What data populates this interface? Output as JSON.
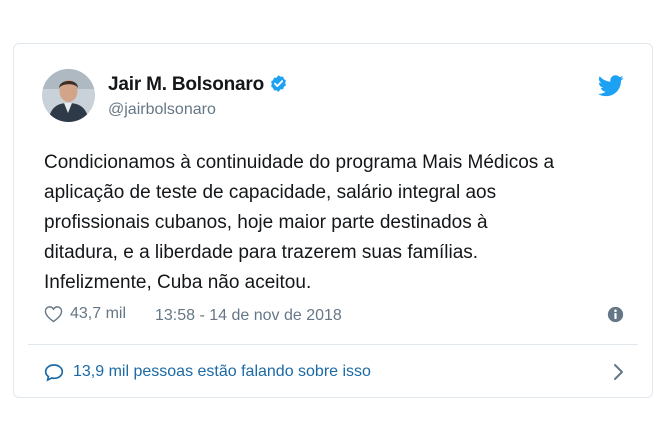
{
  "author": {
    "name": "Jair M. Bolsonaro",
    "handle": "@jairbolsonaro",
    "verified": true,
    "avatar_icon": "profile-photo"
  },
  "brand_icon": "twitter-bird-icon",
  "tweet": {
    "text": "Condicionamos à continuidade do programa Mais Médicos a\naplicação de teste de capacidade, salário integral aos\nprofissionais cubanos, hoje maior parte destinados à\nditadura, e a liberdade para trazerem suas famílias.\nInfelizmente, Cuba não aceitou."
  },
  "meta": {
    "likes": "43,7 mil",
    "timestamp": "13:58 - 14 de nov de 2018"
  },
  "footer": {
    "conversation_label": "13,9 mil pessoas estão falando sobre isso"
  },
  "colors": {
    "brand": "#1da1f2",
    "link": "#1b6aa5",
    "muted": "#657786",
    "text": "#14171a",
    "border": "#e1e8ed"
  }
}
